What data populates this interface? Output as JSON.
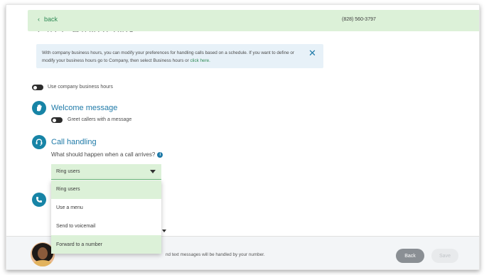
{
  "topbar": {
    "back_label": "back",
    "phone": "(828) 560-3797"
  },
  "header": {
    "cut_title": "CALL HANDLING"
  },
  "banner": {
    "text": "With company business hours, you can modify your preferences for handling calls based on a schedule. If you want to define or modify your business hours go to Company, then select Business hours or ",
    "link": "click here."
  },
  "business_hours": {
    "label": "Use company business hours",
    "enabled": false
  },
  "welcome": {
    "title": "Welcome message",
    "toggle_label": "Greet callers with a message",
    "enabled": false
  },
  "call_handling": {
    "title": "Call handling",
    "question": "What should happen when a call arrives?",
    "selected": "Ring users",
    "options": [
      "Ring users",
      "Use a menu",
      "Send to voicemail",
      "Forward to a number"
    ],
    "selected_index": 0,
    "hovered_index": 3
  },
  "footer": {
    "text": "nd text messages will be handled by your number.",
    "back_label": "Back",
    "save_label": "Save"
  },
  "colors": {
    "accent": "#1f7aa8",
    "green_bg": "#dcf1d8",
    "link_green": "#2f8a55",
    "icon_blue": "#1784a6"
  }
}
